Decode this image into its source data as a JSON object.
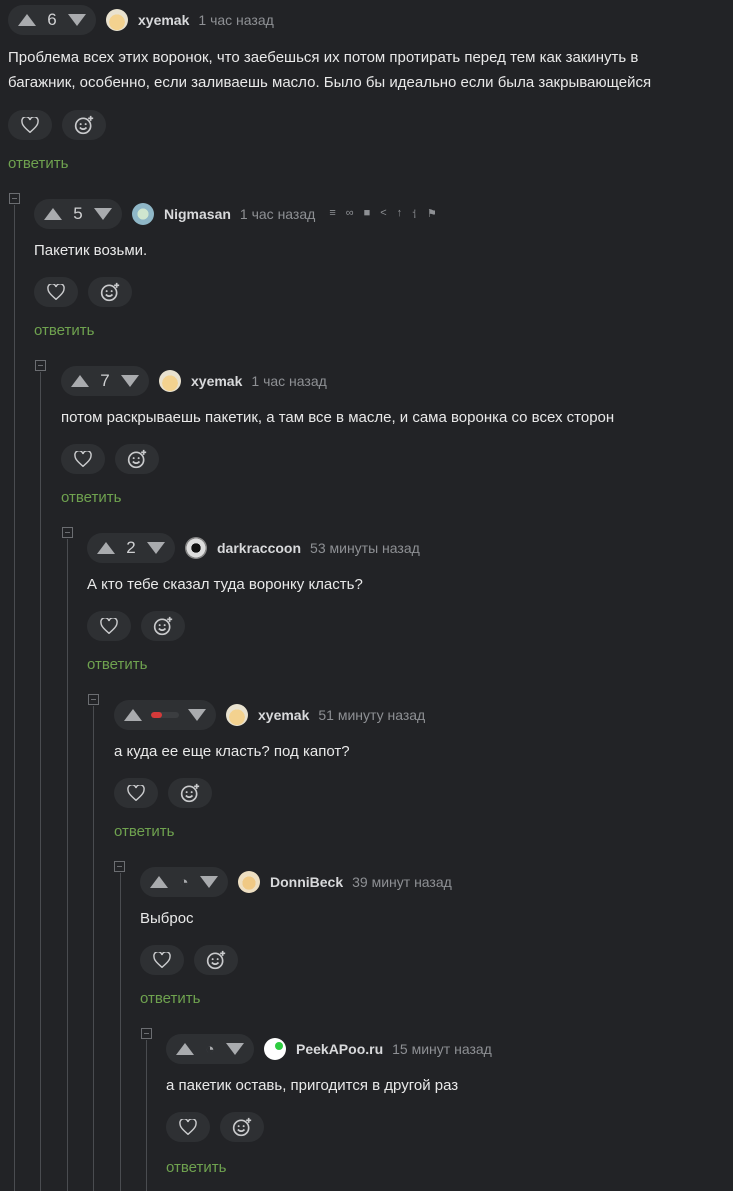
{
  "comments": [
    {
      "score": "6",
      "author": "xyemak",
      "time": "1 час назад",
      "text": "Проблема всех этих воронок, что заебешься их потом протирать перед тем как закинуть в",
      "text2": "багажник, особенно, если заливаешь масло. Было бы идеально если была закрывающейся",
      "reply": "ответить"
    },
    {
      "score": "5",
      "author": "Nigmasan",
      "time": "1 час назад",
      "text": "Пакетик возьми.",
      "reply": "ответить"
    },
    {
      "score": "7",
      "author": "xyemak",
      "time": "1 час назад",
      "text": "потом раскрываешь пакетик, а там все в масле, и сама воронка со всех сторон",
      "reply": "ответить"
    },
    {
      "score": "2",
      "author": "darkraccoon",
      "time": "53 минуты назад",
      "text": "А кто тебе сказал туда воронку класть?",
      "reply": "ответить"
    },
    {
      "score_fraction": 0.4,
      "author": "xyemak",
      "time": "51 минуту назад",
      "text": "а куда ее еще класть? под капот?",
      "reply": "ответить"
    },
    {
      "author": "DonniBeck",
      "time": "39 минут назад",
      "text": "Выброс",
      "reply": "ответить"
    },
    {
      "author": "PeekAPoo.ru",
      "time": "15 минут назад",
      "text": "а пакетик оставь, пригодится в другой раз",
      "reply": "ответить"
    }
  ],
  "icons": {
    "up": "upvote-icon",
    "down": "downvote-icon",
    "heart": "heart-icon",
    "emoji": "add-emoji-icon",
    "pending": "pending-clock-icon",
    "tools": [
      "rss-icon",
      "link-icon",
      "save-icon",
      "share-icon",
      "scroll-to-parent-icon",
      "branch-icon",
      "flag-icon"
    ]
  },
  "colors": {
    "background": "#222326",
    "reply_link": "#6fa24f",
    "negative": "#d53a3a"
  }
}
